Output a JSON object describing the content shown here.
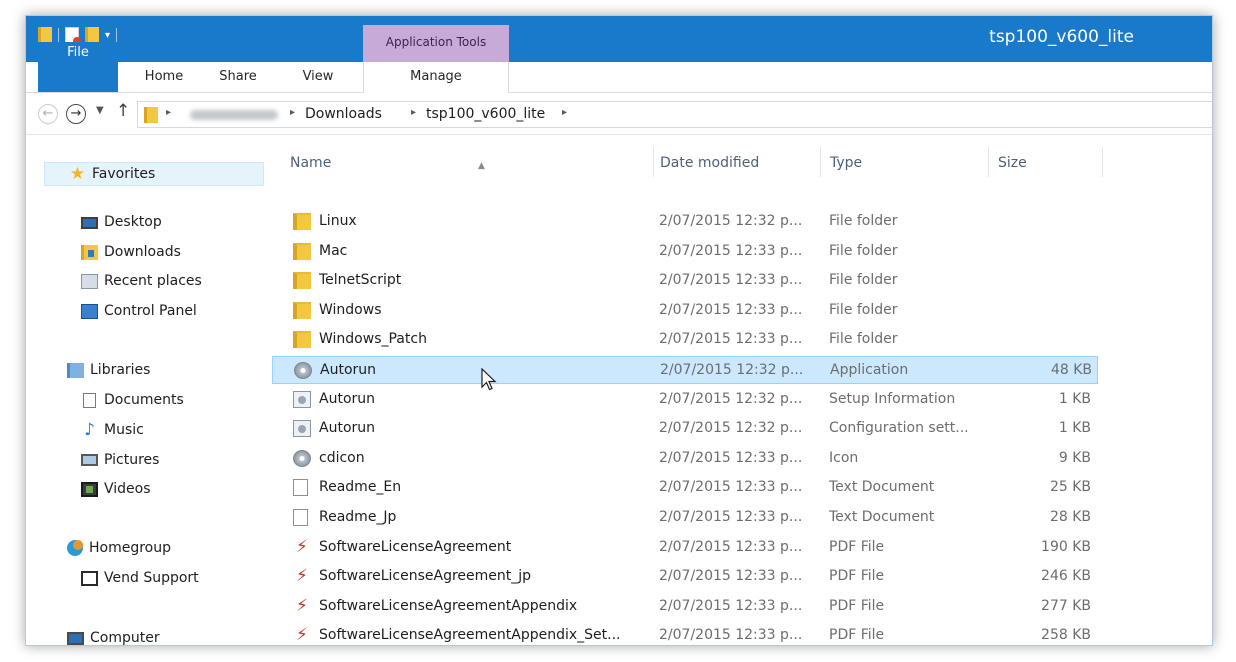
{
  "window": {
    "title": "tsp100_v600_lite",
    "contextual_tab_group": "Application Tools"
  },
  "ribbon": {
    "tabs": [
      {
        "label": "File"
      },
      {
        "label": "Home"
      },
      {
        "label": "Share"
      },
      {
        "label": "View"
      },
      {
        "label": "Manage"
      }
    ]
  },
  "address": {
    "crumbs": [
      "Downloads",
      "tsp100_v600_lite"
    ]
  },
  "navigation": {
    "favorites": {
      "label": "Favorites",
      "items": [
        {
          "label": "Desktop",
          "icon": "desktop-icon"
        },
        {
          "label": "Downloads",
          "icon": "downloads-icon"
        },
        {
          "label": "Recent places",
          "icon": "recent-places-icon"
        },
        {
          "label": "Control Panel",
          "icon": "control-panel-icon"
        }
      ]
    },
    "libraries": {
      "label": "Libraries",
      "items": [
        {
          "label": "Documents",
          "icon": "documents-icon"
        },
        {
          "label": "Music",
          "icon": "music-icon"
        },
        {
          "label": "Pictures",
          "icon": "pictures-icon"
        },
        {
          "label": "Videos",
          "icon": "videos-icon"
        }
      ]
    },
    "homegroup": {
      "label": "Homegroup",
      "items": [
        {
          "label": "Vend Support",
          "icon": "user-icon"
        }
      ]
    },
    "computer": {
      "label": "Computer"
    }
  },
  "columns": {
    "name": "Name",
    "date": "Date modified",
    "type": "Type",
    "size": "Size"
  },
  "files": [
    {
      "name": "Linux",
      "date": "2/07/2015 12:32 p...",
      "type": "File folder",
      "size": "",
      "icon": "folder-icon"
    },
    {
      "name": "Mac",
      "date": "2/07/2015 12:33 p...",
      "type": "File folder",
      "size": "",
      "icon": "folder-icon"
    },
    {
      "name": "TelnetScript",
      "date": "2/07/2015 12:33 p...",
      "type": "File folder",
      "size": "",
      "icon": "folder-icon"
    },
    {
      "name": "Windows",
      "date": "2/07/2015 12:33 p...",
      "type": "File folder",
      "size": "",
      "icon": "folder-icon"
    },
    {
      "name": "Windows_Patch",
      "date": "2/07/2015 12:33 p...",
      "type": "File folder",
      "size": "",
      "icon": "folder-icon"
    },
    {
      "name": "Autorun",
      "date": "2/07/2015 12:32 p...",
      "type": "Application",
      "size": "48 KB",
      "icon": "application-icon",
      "selected": true
    },
    {
      "name": "Autorun",
      "date": "2/07/2015 12:32 p...",
      "type": "Setup Information",
      "size": "1 KB",
      "icon": "setup-information-icon"
    },
    {
      "name": "Autorun",
      "date": "2/07/2015 12:32 p...",
      "type": "Configuration sett...",
      "size": "1 KB",
      "icon": "configuration-icon"
    },
    {
      "name": "cdicon",
      "date": "2/07/2015 12:33 p...",
      "type": "Icon",
      "size": "9 KB",
      "icon": "cd-icon"
    },
    {
      "name": "Readme_En",
      "date": "2/07/2015 12:33 p...",
      "type": "Text Document",
      "size": "25 KB",
      "icon": "text-document-icon"
    },
    {
      "name": "Readme_Jp",
      "date": "2/07/2015 12:33 p...",
      "type": "Text Document",
      "size": "28 KB",
      "icon": "text-document-icon"
    },
    {
      "name": "SoftwareLicenseAgreement",
      "date": "2/07/2015 12:33 p...",
      "type": "PDF File",
      "size": "190 KB",
      "icon": "pdf-icon"
    },
    {
      "name": "SoftwareLicenseAgreement_jp",
      "date": "2/07/2015 12:33 p...",
      "type": "PDF File",
      "size": "246 KB",
      "icon": "pdf-icon"
    },
    {
      "name": "SoftwareLicenseAgreementAppendix",
      "date": "2/07/2015 12:33 p...",
      "type": "PDF File",
      "size": "277 KB",
      "icon": "pdf-icon"
    },
    {
      "name": "SoftwareLicenseAgreementAppendix_Set...",
      "date": "2/07/2015 12:33 p...",
      "type": "PDF File",
      "size": "258 KB",
      "icon": "pdf-icon"
    }
  ],
  "colors": {
    "titlebar": "#1979ca",
    "contextual_group": "#c8aad9",
    "selection": "#cce8ff"
  }
}
